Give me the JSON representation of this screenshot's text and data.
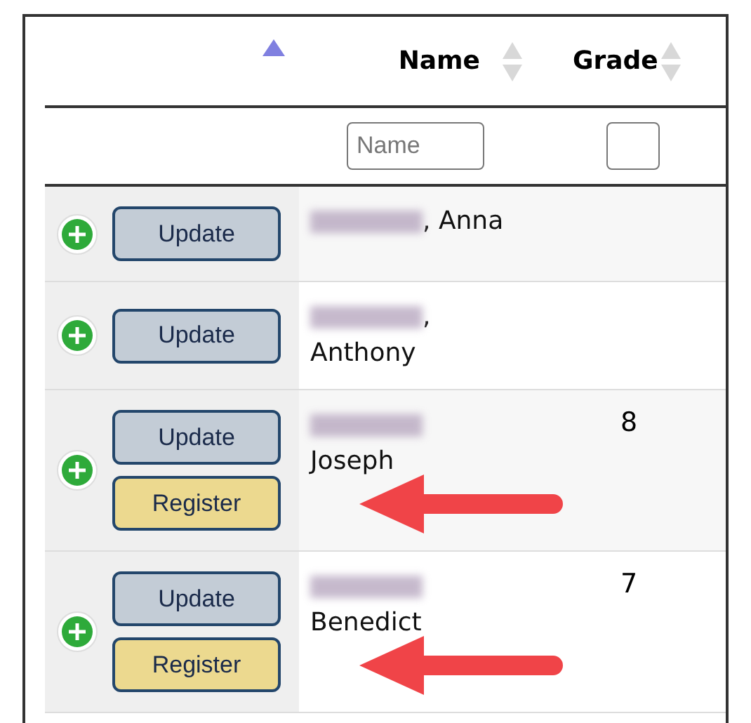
{
  "columns": [
    {
      "sorted": true
    },
    {
      "label": "Name",
      "sorted": false
    },
    {
      "label": "Grade",
      "sorted": false
    }
  ],
  "filters": {
    "name": {
      "placeholder": "Name"
    },
    "grade": {
      "checked": false
    }
  },
  "rows": [
    {
      "surname_redacted": true,
      "name_suffix": ", Anna",
      "buttons": [
        {
          "kind": "update",
          "label": "Update"
        }
      ],
      "highlighted": false
    },
    {
      "surname_redacted": true,
      "name_suffix": ",",
      "first_name": "Anthony",
      "buttons": [
        {
          "kind": "update",
          "label": "Update"
        }
      ],
      "highlighted": false
    },
    {
      "surname_redacted": true,
      "first_name": "Joseph",
      "grade": "8",
      "buttons": [
        {
          "kind": "update",
          "label": "Update"
        },
        {
          "kind": "register",
          "label": "Register"
        }
      ],
      "highlighted": true
    },
    {
      "surname_redacted": true,
      "first_name": "Benedict",
      "grade": "7",
      "buttons": [
        {
          "kind": "update",
          "label": "Update"
        },
        {
          "kind": "register",
          "label": "Register"
        }
      ],
      "highlighted": true
    }
  ]
}
